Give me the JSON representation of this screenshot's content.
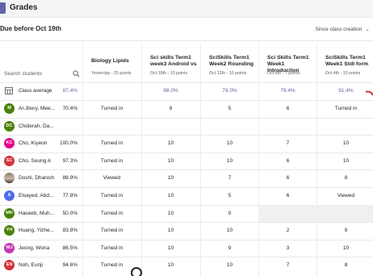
{
  "app": {
    "title": "Grades"
  },
  "toolbar": {
    "due_label": "Due before Oct 19th",
    "sort_label": "Since class creation"
  },
  "search": {
    "placeholder": "Search students"
  },
  "assignments": [
    {
      "title_1": "Biology Lipids",
      "title_2": "",
      "subtitle": "Yesterday - 25 points"
    },
    {
      "title_1": "Sci skills Term1",
      "title_2": "week3 Android vs",
      "subtitle": "Oct 18th - 10 points"
    },
    {
      "title_1": "SciSkills Term1",
      "title_2": "Week2 Rounding",
      "subtitle": "Oct 12th - 10 points"
    },
    {
      "title_1": "Sci Skills Term1",
      "title_2": "Week1 Introduction",
      "subtitle": "Oct 6th - 7 points"
    },
    {
      "title_1": "SciSkills Term1",
      "title_2": "Week1 Stdl form",
      "subtitle": "Oct 4th - 10 points"
    }
  ],
  "class_average": {
    "label": "Class average",
    "percent": "87.4%",
    "cells": [
      "",
      "98.0%",
      "79.0%",
      "79.4%",
      "91.4%"
    ]
  },
  "students": [
    {
      "initials": "M",
      "color": "#498205",
      "name": "Al-Jbory, Mee...",
      "percent": "70.4%",
      "cells": [
        "Turned in",
        "8",
        "5",
        "6",
        "Turned in"
      ]
    },
    {
      "initials": "DC",
      "color": "#498205",
      "name": "Chiderah, Da...",
      "percent": "",
      "cells": [
        "",
        "",
        "",
        "",
        ""
      ]
    },
    {
      "initials": "KC",
      "color": "#e3008c",
      "name": "Cho, Kiyeon",
      "percent": "100.0%",
      "cells": [
        "Turned in",
        "10",
        "10",
        "7",
        "10"
      ]
    },
    {
      "initials": "SC",
      "color": "#d13438",
      "name": "Cho, Seung A",
      "percent": "97.3%",
      "cells": [
        "Turned in",
        "10",
        "10",
        "6",
        "10"
      ]
    },
    {
      "initials": "",
      "color": "photo",
      "name": "Doshi, Dhanish",
      "percent": "88.9%",
      "cells": [
        "Viewed",
        "10",
        "7",
        "6",
        "8"
      ]
    },
    {
      "initials": "A",
      "color": "#4f6bed",
      "name": "Elsayed, Abd...",
      "percent": "77.8%",
      "cells": [
        "Turned in",
        "10",
        "5",
        "6",
        "Viewed"
      ]
    },
    {
      "initials": "MH",
      "color": "#498205",
      "name": "Haseeb, Muh...",
      "percent": "50.0%",
      "cells": [
        "Turned in",
        "10",
        "0",
        "",
        ""
      ]
    },
    {
      "initials": "YH",
      "color": "#498205",
      "name": "Huang, Yizhe...",
      "percent": "83.8%",
      "cells": [
        "Turned in",
        "10",
        "10",
        "2",
        "9"
      ]
    },
    {
      "initials": "WJ",
      "color": "#c239b3",
      "name": "Jeong, Wona",
      "percent": "86.5%",
      "cells": [
        "Turned in",
        "10",
        "9",
        "3",
        "10"
      ]
    },
    {
      "initials": "EN",
      "color": "#d13438",
      "name": "Noh, Eunji",
      "percent": "94.6%",
      "cells": [
        "Turned in",
        "10",
        "10",
        "7",
        "8"
      ]
    }
  ],
  "icons": {
    "search": "search-icon",
    "chevron": "chevron-down-icon",
    "average": "class-average-icon",
    "cursor": "mouse-cursor-icon"
  },
  "colors": {
    "accent": "#6264a7"
  }
}
